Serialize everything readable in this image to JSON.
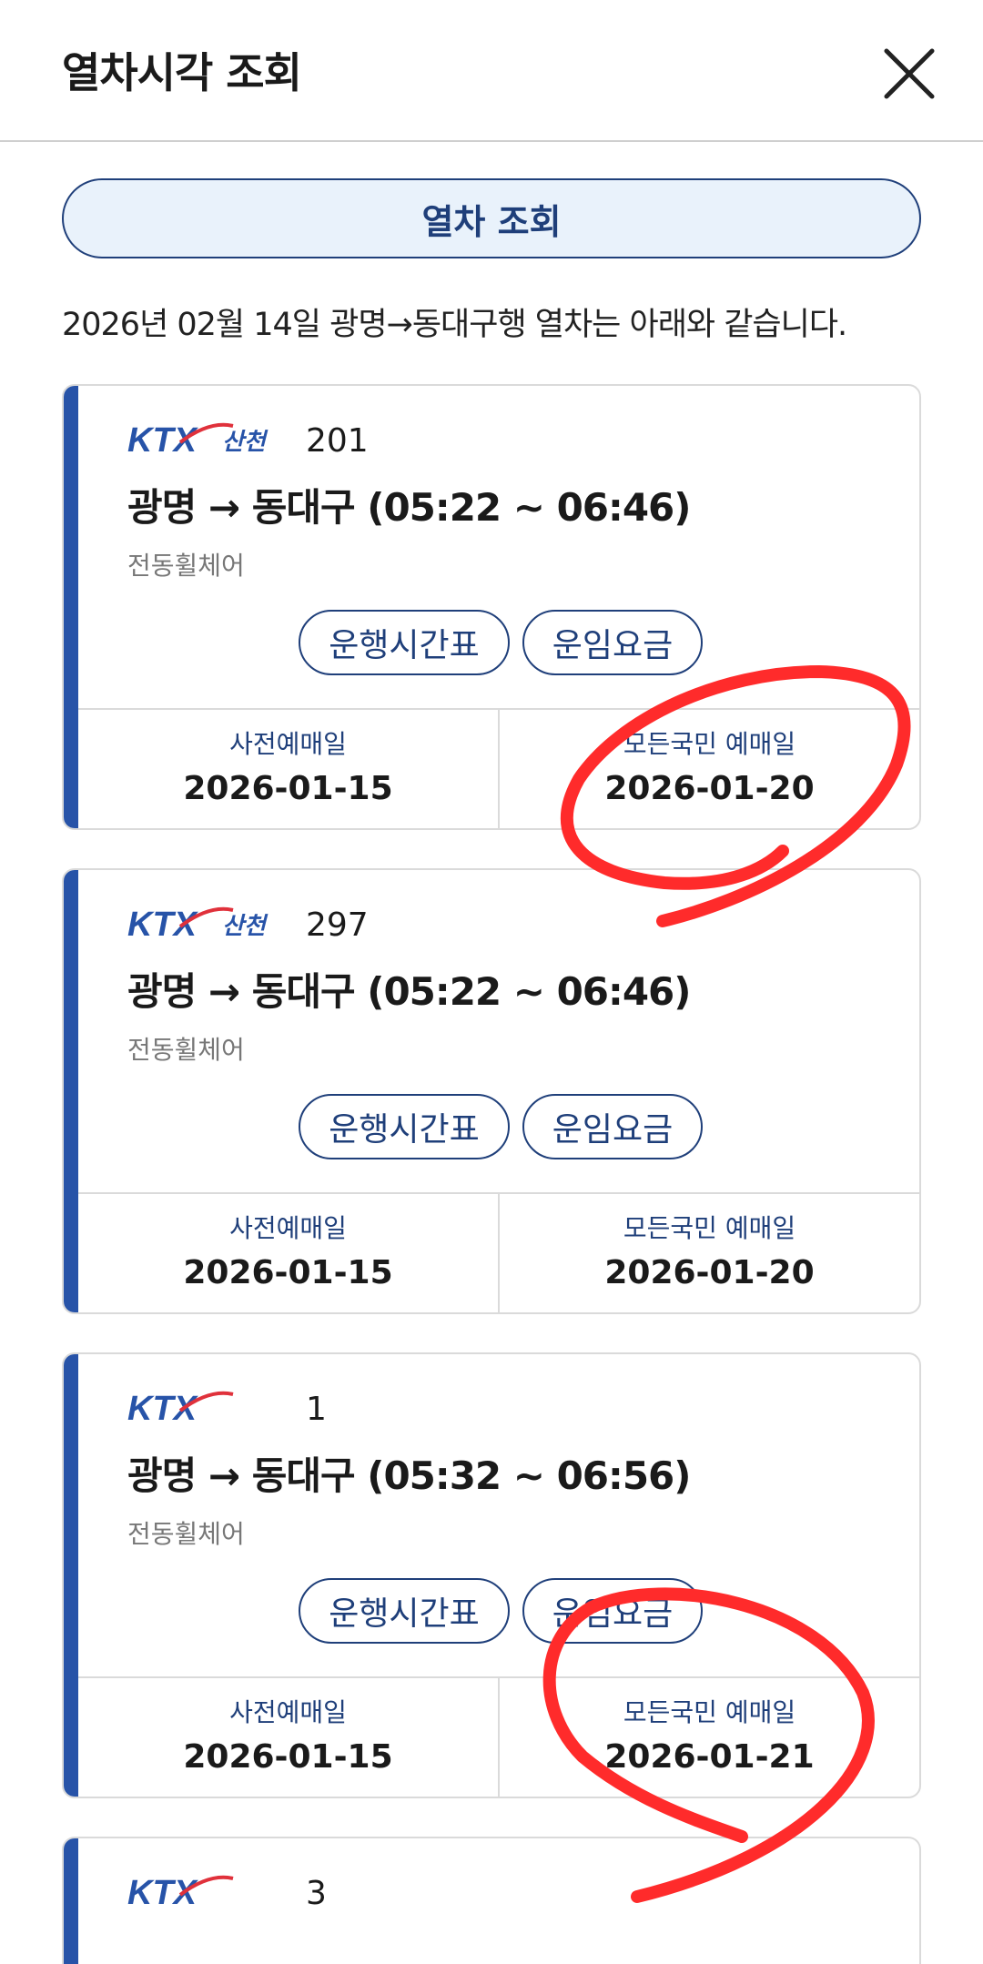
{
  "header": {
    "title": "열차시각 조회",
    "close_icon": "close-icon"
  },
  "query_button": "열차 조회",
  "summary": "2026년 02월 14일 광명→동대구행 열차는 아래와 같습니다.",
  "colors": {
    "accent": "#2753a8",
    "primary": "#1f3f7a",
    "annotation": "#ff2b2b"
  },
  "cards": [
    {
      "brand": "KTX 산천",
      "brand_sub": "산천",
      "train_no": "201",
      "route": "광명 → 동대구 (05:22 ~ 06:46)",
      "car_type": "전동휠체어",
      "timetable": "운행시간표",
      "fare": "운임요금",
      "pre_label": "사전예매일",
      "pre_date": "2026-01-15",
      "public_label": "모든국민 예매일",
      "public_date": "2026-01-20"
    },
    {
      "brand": "KTX 산천",
      "brand_sub": "산천",
      "train_no": "297",
      "route": "광명 → 동대구 (05:22 ~ 06:46)",
      "car_type": "전동휠체어",
      "timetable": "운행시간표",
      "fare": "운임요금",
      "pre_label": "사전예매일",
      "pre_date": "2026-01-15",
      "public_label": "모든국민 예매일",
      "public_date": "2026-01-20"
    },
    {
      "brand": "KTX",
      "train_no": "1",
      "route": "광명 → 동대구 (05:32 ~ 06:56)",
      "car_type": "전동휠체어",
      "timetable": "운행시간표",
      "fare": "운임요금",
      "pre_label": "사전예매일",
      "pre_date": "2026-01-15",
      "public_label": "모든국민 예매일",
      "public_date": "2026-01-21"
    },
    {
      "brand": "KTX",
      "train_no": "3"
    }
  ]
}
